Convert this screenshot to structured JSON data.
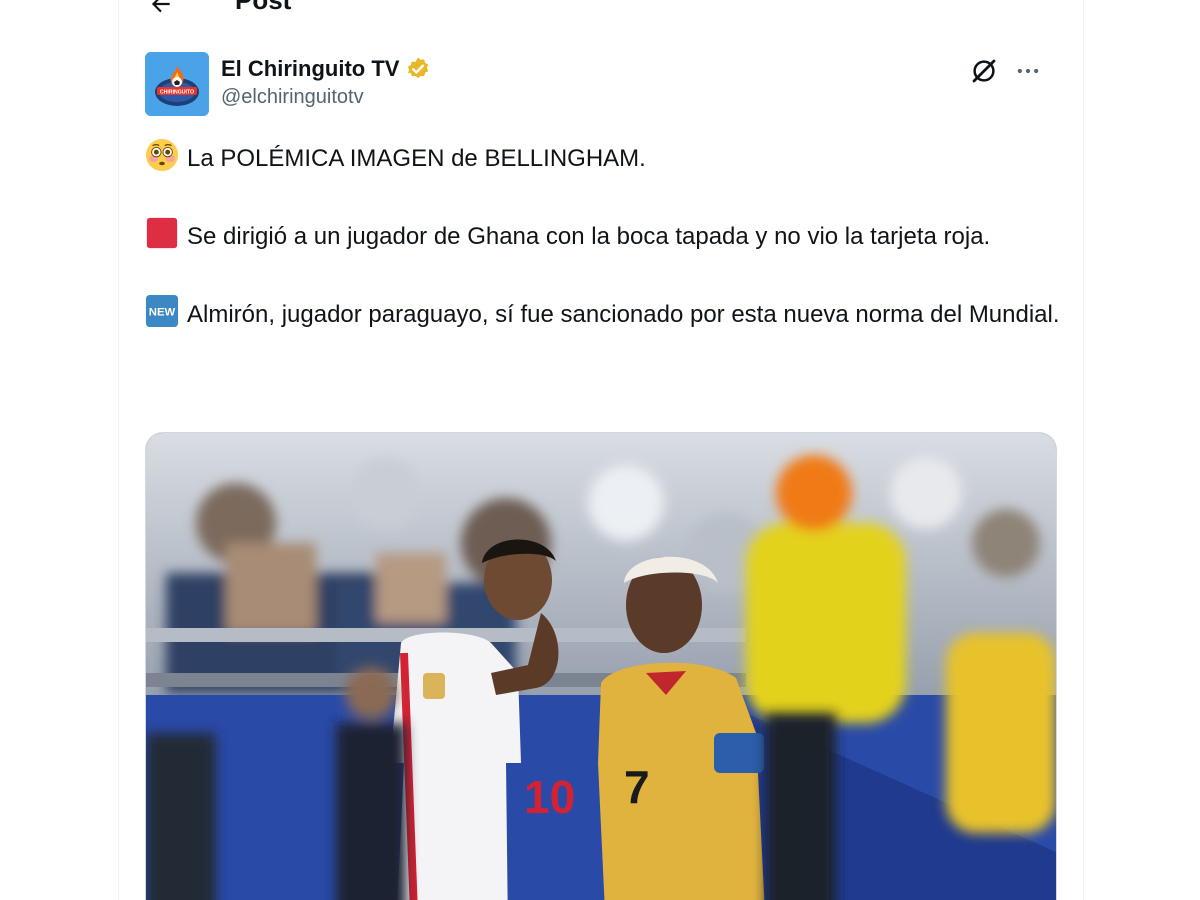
{
  "header": {
    "title": "Post",
    "back_icon": "arrow-left-icon"
  },
  "author": {
    "display_name": "El Chiringuito TV",
    "handle": "@elchiringuitotv",
    "verified_icon": "verified-badge-icon",
    "verified_color": "#e8b829",
    "avatar_text": "CHIRINGUITO"
  },
  "actions": {
    "grok_icon": "grok-icon",
    "more_icon": "more-horizontal-icon"
  },
  "tweet": {
    "line1_emoji": "flushed-face-emoji",
    "line1": "La POLÉMICA IMAGEN de BELLINGHAM.",
    "line2_emoji": "red-card-emoji",
    "line2": "Se dirigió a un jugador de Ghana con la boca tapada y no vio la tarjeta roja.",
    "line3_emoji": "new-button-emoji",
    "line3_emoji_text": "NEW",
    "line3": "Almirón, jugador paraguayo, sí fue sancionado por esta nueva norma del Mundial."
  },
  "media": {
    "left_player_number": "10",
    "right_player_number": "7"
  },
  "colors": {
    "text_primary": "#0f1419",
    "text_secondary": "#536471",
    "border": "#eff3f4"
  }
}
